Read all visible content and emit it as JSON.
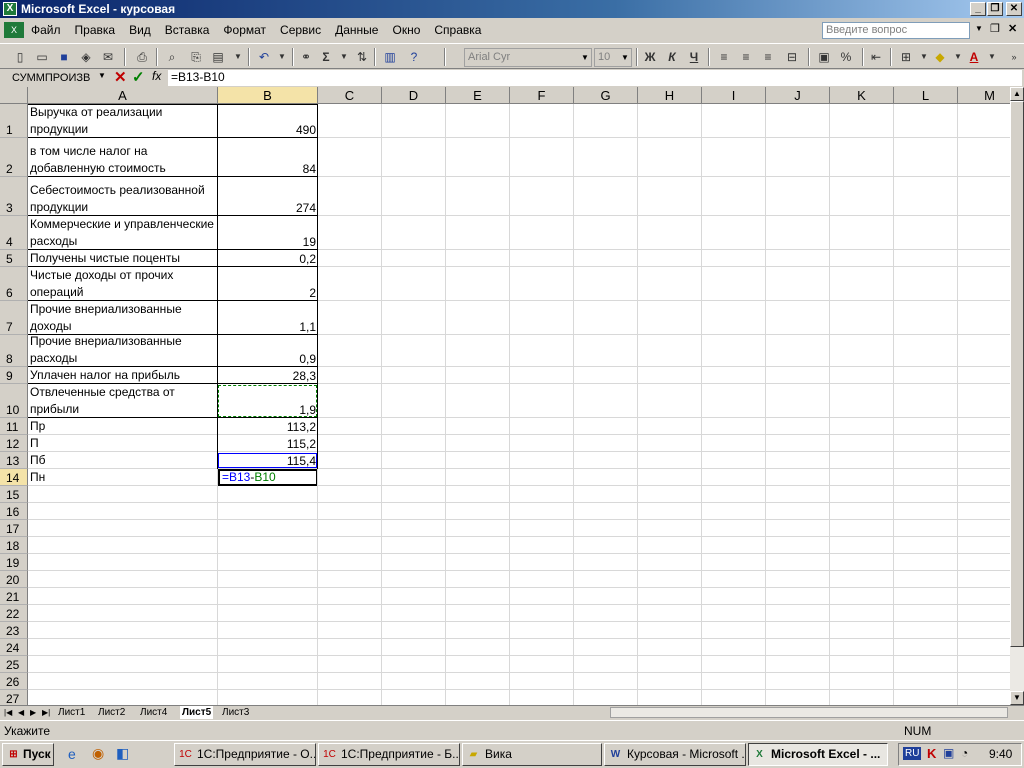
{
  "window": {
    "title": "Microsoft Excel - курсовая"
  },
  "menu": [
    "Файл",
    "Правка",
    "Вид",
    "Вставка",
    "Формат",
    "Сервис",
    "Данные",
    "Окно",
    "Справка"
  ],
  "help": {
    "placeholder": "Введите вопрос"
  },
  "toolbar": {
    "font": "Arial Cyr",
    "size": "10",
    "bold": "Ж",
    "italic": "К",
    "underline": "Ч",
    "sigma": "Σ",
    "percent": "%"
  },
  "formula_bar": {
    "name_box": "СУММПРОИЗВ",
    "fx": "fx",
    "formula": "=B13-B10"
  },
  "columns": [
    "A",
    "B",
    "C",
    "D",
    "E",
    "F",
    "G",
    "H",
    "I",
    "J",
    "K",
    "L",
    "M"
  ],
  "rows": [
    {
      "n": "1",
      "a": "Выручка от реализации продукции",
      "b": "490"
    },
    {
      "n": "2",
      "a": "в том числе налог на добавленную стоимость",
      "b": "84"
    },
    {
      "n": "3",
      "a": "Себестоимость реализованной продукции",
      "b": "274"
    },
    {
      "n": "4",
      "a": "Коммерческие и управленческие расходы",
      "b": "19"
    },
    {
      "n": "5",
      "a": "Получены чистые поценты",
      "b": "0,2"
    },
    {
      "n": "6",
      "a": "Чистые доходы от прочих операций",
      "b": "2"
    },
    {
      "n": "7",
      "a": "Прочие внериализованные доходы",
      "b": "1,1"
    },
    {
      "n": "8",
      "a": "Прочие внериализованные расходы",
      "b": "0,9"
    },
    {
      "n": "9",
      "a": "Уплачен налог на прибыль",
      "b": "28,3"
    },
    {
      "n": "10",
      "a": "Отвлеченные средства от прибыли",
      "b": "1,9"
    },
    {
      "n": "11",
      "a": "Пр",
      "b": "113,2"
    },
    {
      "n": "12",
      "a": "П",
      "b": "115,2"
    },
    {
      "n": "13",
      "a": "Пб",
      "b": "115,4"
    },
    {
      "n": "14",
      "a": "Пн",
      "b": "=B13-B10"
    },
    {
      "n": "15",
      "a": "",
      "b": ""
    },
    {
      "n": "16",
      "a": "",
      "b": ""
    },
    {
      "n": "17",
      "a": "",
      "b": ""
    },
    {
      "n": "18",
      "a": "",
      "b": ""
    },
    {
      "n": "19",
      "a": "",
      "b": ""
    },
    {
      "n": "20",
      "a": "",
      "b": ""
    },
    {
      "n": "21",
      "a": "",
      "b": ""
    },
    {
      "n": "22",
      "a": "",
      "b": ""
    },
    {
      "n": "23",
      "a": "",
      "b": ""
    },
    {
      "n": "24",
      "a": "",
      "b": ""
    },
    {
      "n": "25",
      "a": "",
      "b": ""
    },
    {
      "n": "26",
      "a": "",
      "b": ""
    },
    {
      "n": "27",
      "a": "",
      "b": ""
    }
  ],
  "edit_cell": {
    "ref1": "=B13",
    "op": "-",
    "ref2": "B10"
  },
  "sheets": [
    "Лист1",
    "Лист2",
    "Лист4",
    "Лист5",
    "Лист3"
  ],
  "active_sheet": "Лист5",
  "status": {
    "mode": "Укажите",
    "num": "NUM"
  },
  "taskbar": {
    "start": "Пуск",
    "tasks": [
      "1С:Предприятие - О...",
      "1С:Предприятие - Б...",
      "Вика",
      "Курсовая - Microsoft ...",
      "Microsoft Excel - ..."
    ],
    "lang": "RU",
    "clock": "9:40"
  },
  "colors": {
    "accent": "#0a246a",
    "selection_header": "#f4e3a8",
    "ref_blue": "#0000ff",
    "ref_green": "#008000"
  }
}
